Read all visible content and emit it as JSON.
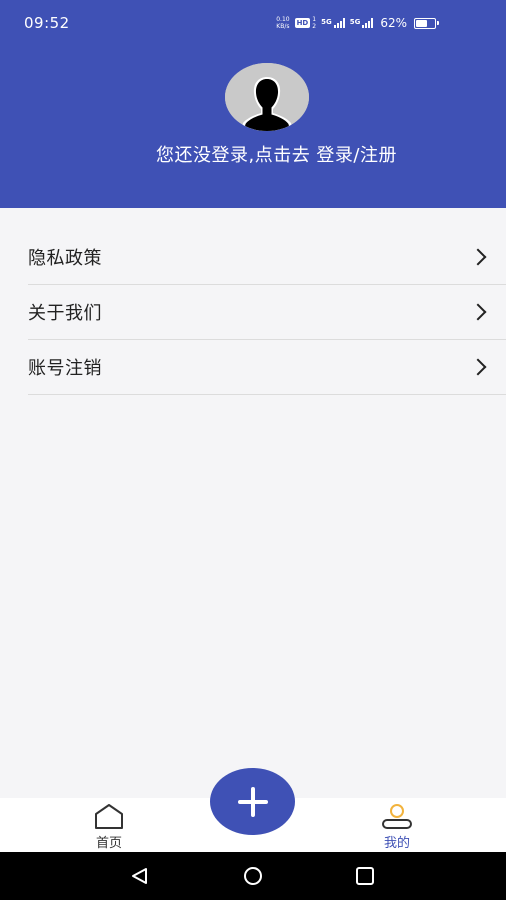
{
  "status_bar": {
    "time": "09:52",
    "net_speed_value": "0.10",
    "net_speed_unit": "KB/s",
    "hd_badge": "HD",
    "sim1_label": "1",
    "sim2_label": "2",
    "signal1_label": "5G",
    "signal2_label": "5G",
    "battery_percent": "62%",
    "battery_level": 0.62
  },
  "profile": {
    "avatar_icon": "default-user-avatar",
    "login_prompt": "您还没登录,点击去 登录/注册"
  },
  "menu": {
    "items": [
      {
        "label": "隐私政策",
        "icon": "chevron-right-icon"
      },
      {
        "label": "关于我们",
        "icon": "chevron-right-icon"
      },
      {
        "label": "账号注销",
        "icon": "chevron-right-icon"
      }
    ]
  },
  "bottom_nav": {
    "tabs": [
      {
        "label": "首页",
        "icon": "home-icon",
        "active": false
      },
      {
        "label": "我的",
        "icon": "person-icon",
        "active": true
      }
    ],
    "fab_icon": "plus-icon"
  },
  "colors": {
    "primary": "#3f51b5",
    "background": "#f5f5f7",
    "accent_person_head": "#f2b33d"
  }
}
